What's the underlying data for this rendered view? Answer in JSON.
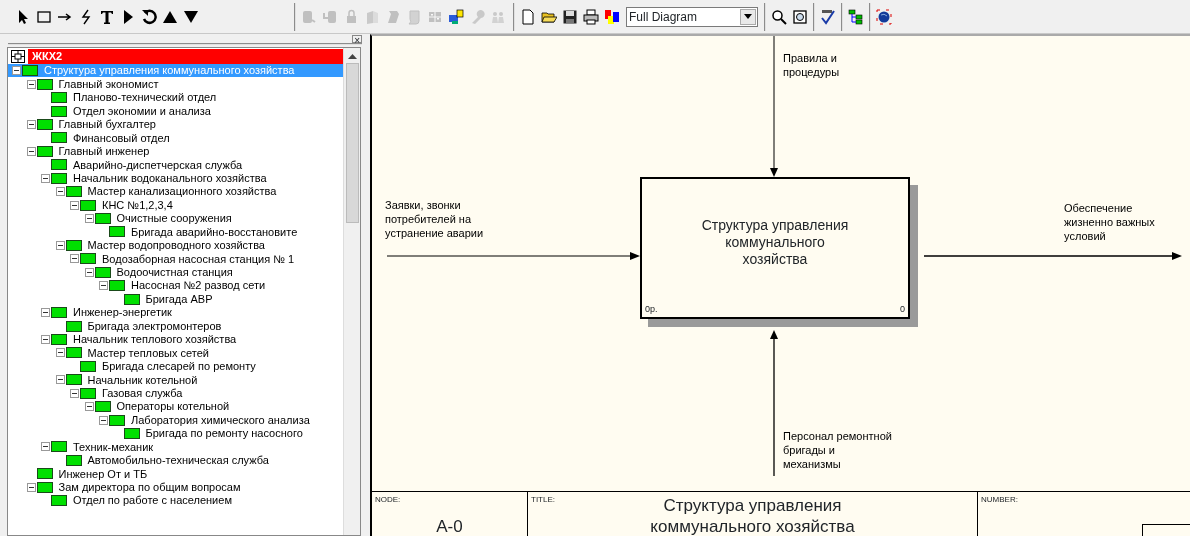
{
  "toolbar": {
    "buttons": [
      {
        "kind": "pointer",
        "disabled": false
      },
      {
        "kind": "box",
        "disabled": false
      },
      {
        "kind": "arrow",
        "disabled": false
      },
      {
        "kind": "squiggle",
        "disabled": false
      },
      {
        "kind": "text",
        "disabled": false
      },
      {
        "kind": "play",
        "disabled": false
      },
      {
        "kind": "rotate",
        "disabled": false
      },
      {
        "kind": "up",
        "disabled": false
      },
      {
        "kind": "down",
        "disabled": false
      },
      {
        "kind": "sep2"
      },
      {
        "kind": "link",
        "disabled": true
      },
      {
        "kind": "unlink",
        "disabled": true
      },
      {
        "kind": "lock",
        "disabled": true
      },
      {
        "kind": "sheet",
        "disabled": true
      },
      {
        "kind": "doc",
        "disabled": true
      },
      {
        "kind": "scroll",
        "disabled": true
      },
      {
        "kind": "grid",
        "disabled": true
      },
      {
        "kind": "objects",
        "disabled": false
      },
      {
        "kind": "wrench",
        "disabled": true
      },
      {
        "kind": "people",
        "disabled": true
      },
      {
        "kind": "sep2"
      },
      {
        "kind": "new",
        "disabled": false
      },
      {
        "kind": "open",
        "disabled": false
      },
      {
        "kind": "save",
        "disabled": false
      },
      {
        "kind": "print",
        "disabled": false
      },
      {
        "kind": "colors",
        "disabled": false
      }
    ],
    "diagram_select": {
      "value": "Full Diagram"
    },
    "buttons_after": [
      {
        "kind": "zoom",
        "disabled": false
      },
      {
        "kind": "zoomfit",
        "disabled": false
      },
      {
        "kind": "spell",
        "disabled": false
      },
      {
        "kind": "tree",
        "disabled": false
      },
      {
        "kind": "globe",
        "disabled": false
      }
    ]
  },
  "panel": {
    "close": "×"
  },
  "model": {
    "name": "ЖКХ2"
  },
  "tree": [
    {
      "label": "Структура управления  коммунального  хозяйства",
      "selected": true,
      "expanded": true,
      "children": [
        {
          "label": "Главный экономист",
          "selected": false,
          "expanded": true,
          "children": [
            {
              "label": "Планово-технический отдел",
              "selected": false
            },
            {
              "label": "Отдел экономии и анализа",
              "selected": false
            }
          ]
        },
        {
          "label": "Главный  бухгалтер",
          "selected": false,
          "expanded": true,
          "children": [
            {
              "label": "Финансовый  отдел",
              "selected": false
            }
          ]
        },
        {
          "label": "Главный инженер",
          "selected": false,
          "expanded": true,
          "children": [
            {
              "label": "Аварийно-диспетчерская служба",
              "selected": false
            },
            {
              "label": "Начальник водоканального хозяйства",
              "selected": false,
              "expanded": true,
              "children": [
                {
                  "label": "Мастер канализационного хозяйства",
                  "selected": false,
                  "expanded": true,
                  "children": [
                    {
                      "label": "КНС №1,2,3,4",
                      "selected": false,
                      "expanded": true,
                      "children": [
                        {
                          "label": "Очистные сооружения",
                          "selected": false,
                          "expanded": true,
                          "children": [
                            {
                              "label": "Бригада аварийно-восстановите",
                              "selected": false
                            }
                          ]
                        }
                      ]
                    }
                  ]
                },
                {
                  "label": "Мастер водопроводного хозяйства",
                  "selected": false,
                  "expanded": true,
                  "children": [
                    {
                      "label": "Водозаборная насосная станция № 1",
                      "selected": false,
                      "expanded": true,
                      "children": [
                        {
                          "label": "Водоочистная станция",
                          "selected": false,
                          "expanded": true,
                          "children": [
                            {
                              "label": "Насосная №2 развод сети",
                              "selected": false,
                              "expanded": true,
                              "children": [
                                {
                                  "label": "Бригада АВР",
                                  "selected": false
                                }
                              ]
                            }
                          ]
                        }
                      ]
                    }
                  ]
                }
              ]
            },
            {
              "label": "Инженер-энергетик",
              "selected": false,
              "expanded": true,
              "children": [
                {
                  "label": "Бригада электромонтеров",
                  "selected": false
                }
              ]
            },
            {
              "label": "Начальник теплового  хозяйства",
              "selected": false,
              "expanded": true,
              "children": [
                {
                  "label": "Мастер тепловых  сетей",
                  "selected": false,
                  "expanded": true,
                  "children": [
                    {
                      "label": "Бригада слесарей  по ремонту",
                      "selected": false
                    }
                  ]
                },
                {
                  "label": "Начальник  котельной",
                  "selected": false,
                  "expanded": true,
                  "children": [
                    {
                      "label": "Газовая служба",
                      "selected": false,
                      "expanded": true,
                      "children": [
                        {
                          "label": "Операторы котельной",
                          "selected": false,
                          "expanded": true,
                          "children": [
                            {
                              "label": "Лаборатория химического анализа",
                              "selected": false,
                              "expanded": true,
                              "children": [
                                {
                                  "label": "Бригада по ремонту насосного",
                                  "selected": false
                                }
                              ]
                            }
                          ]
                        }
                      ]
                    }
                  ]
                }
              ]
            },
            {
              "label": "Техник-механик",
              "selected": false,
              "expanded": true,
              "children": [
                {
                  "label": "Автомобильно-техническая служба",
                  "selected": false
                }
              ]
            }
          ]
        },
        {
          "label": "Инженер От и ТБ",
          "selected": false
        },
        {
          "label": "Зам директора по общим вопросам",
          "selected": false,
          "expanded": true,
          "children": [
            {
              "label": "Отдел по работе с населением",
              "selected": false
            }
          ]
        }
      ]
    }
  ],
  "diagram": {
    "activity": {
      "title": "Структура управления коммунального хозяйства",
      "cost": "0р.",
      "number": "0"
    },
    "control": "Правила и процедуры",
    "input": "Заявки, звонки потребителей  на устранение аварии",
    "output": "Обеспечение жизненно  важных условий",
    "mechanism": "Персонал ремонтной бригады и механизмы"
  },
  "frame": {
    "node_label": "NODE:",
    "node": "A-0",
    "title_label": "TITLE:",
    "title": "Структура управления  коммунального хозяйства",
    "number_label": "NUMBER:"
  }
}
